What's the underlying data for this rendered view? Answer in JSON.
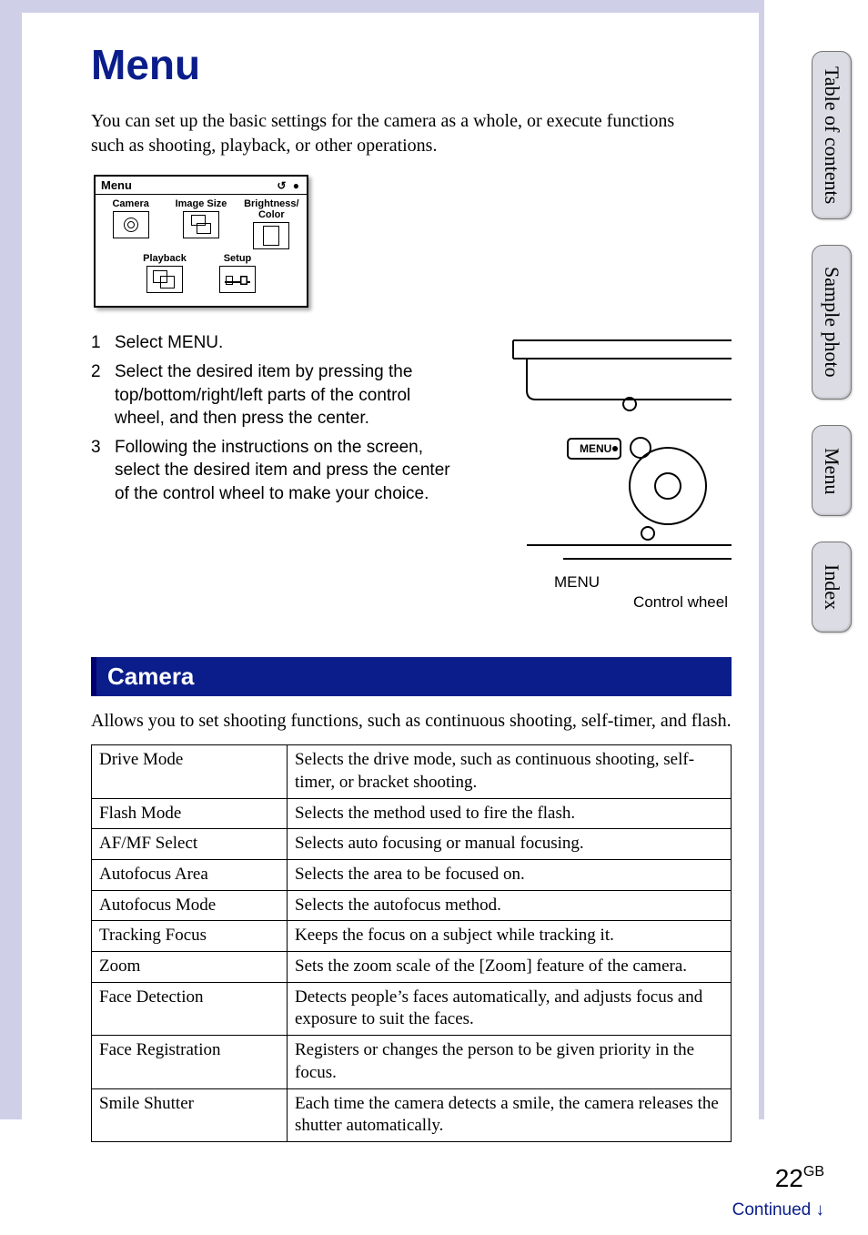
{
  "page": {
    "title": "Menu",
    "intro": "You can set up the basic settings for the camera as a whole, or execute functions such as shooting, playback, or other operations.",
    "number": "22",
    "region": "GB",
    "continued": "Continued ↓"
  },
  "menu_screen": {
    "header": "Menu",
    "header_icons": "↺ ●",
    "items": {
      "camera": "Camera",
      "image_size": "Image Size",
      "brightness": "Brightness/\nColor",
      "playback": "Playback",
      "setup": "Setup"
    }
  },
  "steps": [
    {
      "num": "1",
      "text": "Select MENU."
    },
    {
      "num": "2",
      "text": "Select the desired item by pressing the top/bottom/right/left parts of the control wheel, and then press the center."
    },
    {
      "num": "3",
      "text": "Following the instructions on the screen, select the desired item and press the center of the control wheel to make your choice."
    }
  ],
  "diagram": {
    "menu_button_text": "MENU",
    "menu_label": "MENU",
    "wheel_label": "Control wheel"
  },
  "section": {
    "title": "Camera",
    "intro": "Allows you to set shooting functions, such as continuous shooting, self-timer, and flash.",
    "rows": [
      {
        "name": "Drive Mode",
        "desc": "Selects the drive mode, such as continuous shooting, self-timer, or bracket shooting."
      },
      {
        "name": "Flash Mode",
        "desc": "Selects the method used to fire the flash."
      },
      {
        "name": "AF/MF Select",
        "desc": "Selects auto focusing or manual focusing."
      },
      {
        "name": "Autofocus Area",
        "desc": "Selects the area to be focused on."
      },
      {
        "name": "Autofocus Mode",
        "desc": "Selects the autofocus method."
      },
      {
        "name": "Tracking Focus",
        "desc": "Keeps the focus on a subject while tracking it."
      },
      {
        "name": "Zoom",
        "desc": "Sets the zoom scale of the [Zoom] feature of the camera."
      },
      {
        "name": "Face Detection",
        "desc": "Detects people’s faces automatically, and adjusts focus and exposure to suit the faces."
      },
      {
        "name": "Face Registration",
        "desc": "Registers or changes the person to be given priority in the focus."
      },
      {
        "name": "Smile Shutter",
        "desc": "Each time the camera detects a smile, the camera releases the shutter automatically."
      }
    ]
  },
  "side_tabs": [
    "Table of contents",
    "Sample photo",
    "Menu",
    "Index"
  ]
}
